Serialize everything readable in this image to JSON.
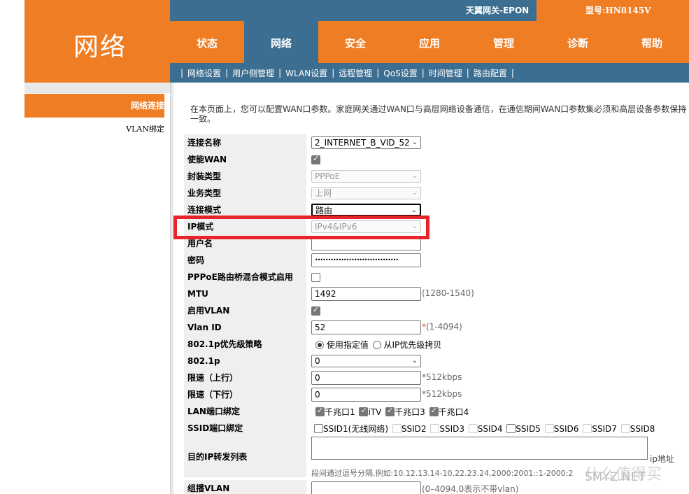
{
  "header": {
    "section_title": "网络",
    "product": "天翼网关-EPON",
    "model": "型号:HN8145V"
  },
  "nav": {
    "items": [
      "状态",
      "网络",
      "安全",
      "应用",
      "管理",
      "诊断",
      "帮助"
    ],
    "active_index": 1
  },
  "subnav": {
    "items": [
      "网络设置",
      "用户侧管理",
      "WLAN设置",
      "远程管理",
      "QoS设置",
      "时间管理",
      "路由配置"
    ]
  },
  "sidebar": {
    "items": [
      "网络连接",
      "VLAN绑定"
    ],
    "active_index": 0
  },
  "description": "在本页面上，您可以配置WAN口参数。家庭网关通过WAN口与高层网络设备通信，在通信期间WAN口参数集必须和高层设备参数保持一致。",
  "form": {
    "connection_name": {
      "label": "连接名称",
      "value": "2_INTERNET_B_VID_52"
    },
    "enable_wan": {
      "label": "使能WAN",
      "checked": true
    },
    "encap_type": {
      "label": "封装类型",
      "value": "PPPoE"
    },
    "service_type": {
      "label": "业务类型",
      "value": "上网"
    },
    "conn_mode": {
      "label": "连接模式",
      "value": "路由"
    },
    "ip_mode": {
      "label": "IP模式",
      "value": "IPv4&IPv6"
    },
    "username": {
      "label": "用户名",
      "value": ""
    },
    "password": {
      "label": "密码",
      "value": "••••••••••••••••••••••••••••••••"
    },
    "pppoe_bridge": {
      "label": "PPPoE路由桥混合模式启用",
      "checked": false
    },
    "mtu": {
      "label": "MTU",
      "value": "1492",
      "hint": "(1280-1540)"
    },
    "enable_vlan": {
      "label": "启用VLAN",
      "checked": true
    },
    "vlan_id": {
      "label": "Vlan ID",
      "value": "52",
      "hint_star": "*",
      "hint": "(1-4094)"
    },
    "priority_policy": {
      "label": "802.1p优先级策略",
      "opt1": "使用指定值",
      "opt2": "从IP优先级拷贝"
    },
    "p8021": {
      "label": "802.1p",
      "value": "0"
    },
    "rate_up": {
      "label": "限速（上行）",
      "value": "0",
      "hint": "*512kbps"
    },
    "rate_down": {
      "label": "限速（下行）",
      "value": "0",
      "hint": "*512kbps"
    },
    "lan_bind": {
      "label": "LAN端口绑定",
      "ports": [
        "千兆口1",
        "iTV",
        "千兆口3",
        "千兆口4"
      ]
    },
    "ssid_bind": {
      "label": "SSID端口绑定",
      "ssids": [
        "SSID1(无线网络)",
        "SSID2",
        "SSID3",
        "SSID4",
        "SSID5",
        "SSID6",
        "SSID7",
        "SSID8"
      ]
    },
    "ip_forward": {
      "label": "目的IP转发列表",
      "suffix": "ip地址",
      "note": "段间通过逗号分隔,例如:10.12.13.14-10.22.23.24,2000:2001::1-2000:2"
    },
    "multicast_vlan": {
      "label": "组播VLAN",
      "value": "",
      "hint": "(0–4094,0表示不带vlan)"
    }
  },
  "watermark": {
    "text": "SMYZ.NET",
    "text_cn": "什么值得买"
  }
}
